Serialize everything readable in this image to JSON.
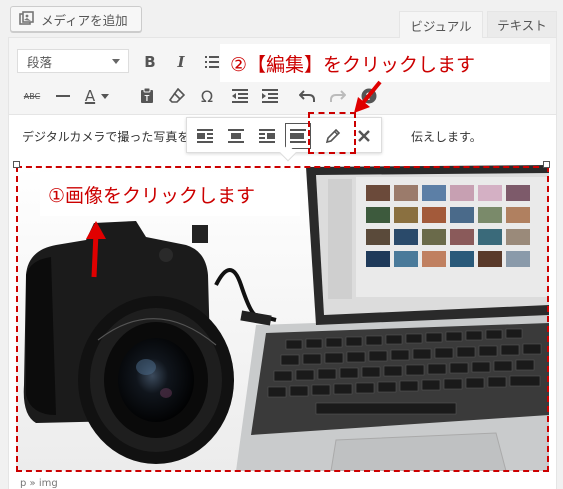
{
  "media_button": {
    "label": "メディアを追加",
    "icon": "media-icon"
  },
  "tabs": {
    "visual": "ビジュアル",
    "text": "テキスト"
  },
  "toolbar": {
    "format_value": "段落",
    "row1": [
      "bold-icon",
      "italic-icon",
      "list-icon"
    ],
    "row2": [
      "strikethrough-icon",
      "horizontal-line-icon",
      "text-color-icon",
      "paste-text-icon",
      "clear-format-icon",
      "special-char-icon",
      "outdent-icon",
      "indent-icon",
      "undo-icon",
      "redo-icon",
      "help-icon"
    ],
    "bold_glyph": "B",
    "italic_glyph": "I",
    "abc_glyph": "ABC",
    "omega_glyph": "Ω",
    "a_glyph": "A"
  },
  "annotations": {
    "step2": "②【編集】をクリックします",
    "step1": "①画像をクリックします"
  },
  "content": {
    "paragraph_start": "デジタルカメラで撮った写真を",
    "paragraph_end": "伝えします。"
  },
  "image_toolbar": {
    "items": [
      "align-left-icon",
      "align-center-icon",
      "align-right-icon",
      "align-none-icon",
      "edit-pencil-icon",
      "remove-icon"
    ]
  },
  "statusbar": {
    "path": "p » img"
  },
  "colors": {
    "annotation": "#cc0000",
    "arrow": "#e00000"
  }
}
